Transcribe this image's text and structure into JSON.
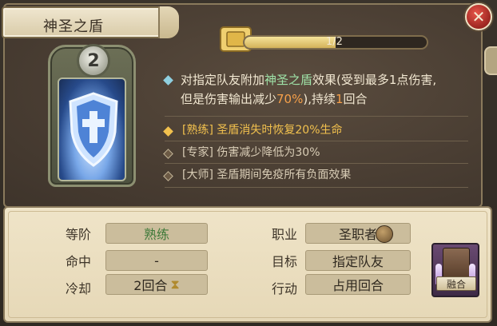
{
  "skill": {
    "name": "神圣之盾",
    "level": "2",
    "progress_text": "1/2",
    "progress_fraction": 0.5
  },
  "description": {
    "line1_a": "对指定队友附加",
    "line1_hl": "神圣之盾",
    "line1_b": "效果(受到最多1点伤害,",
    "line2_a": "但是伤害输出减少",
    "line2_hl": "70%",
    "line2_b": "),持续",
    "line2_hl2": "1",
    "line2_c": "回合"
  },
  "tiers": [
    {
      "label": "[熟练]  圣盾消失时恢复20%生命",
      "active": true
    },
    {
      "label": "[专家]  伤害减少降低为30%",
      "active": false
    },
    {
      "label": "[大师]  圣盾期间免疫所有负面效果",
      "active": false
    }
  ],
  "stats": {
    "rank_label": "等阶",
    "rank_value": "熟练",
    "hit_label": "命中",
    "hit_value": "-",
    "cooldown_label": "冷却",
    "cooldown_value": "2回合",
    "class_label": "职业",
    "class_value": "圣职者",
    "target_label": "目标",
    "target_value": "指定队友",
    "action_label": "行动",
    "action_value": "占用回合"
  },
  "fuse_button": {
    "label": "融合"
  },
  "colors": {
    "highlight_green": "#9fe3a8",
    "highlight_orange": "#f6a04a",
    "active_tier": "#f2c14e",
    "close_red": "#9c2620"
  },
  "icons": {
    "close": "x-icon",
    "shield": "holy-shield-icon",
    "hourglass": "hourglass-icon",
    "hammer": "hammer-icon",
    "xp": "scroll-icon"
  }
}
